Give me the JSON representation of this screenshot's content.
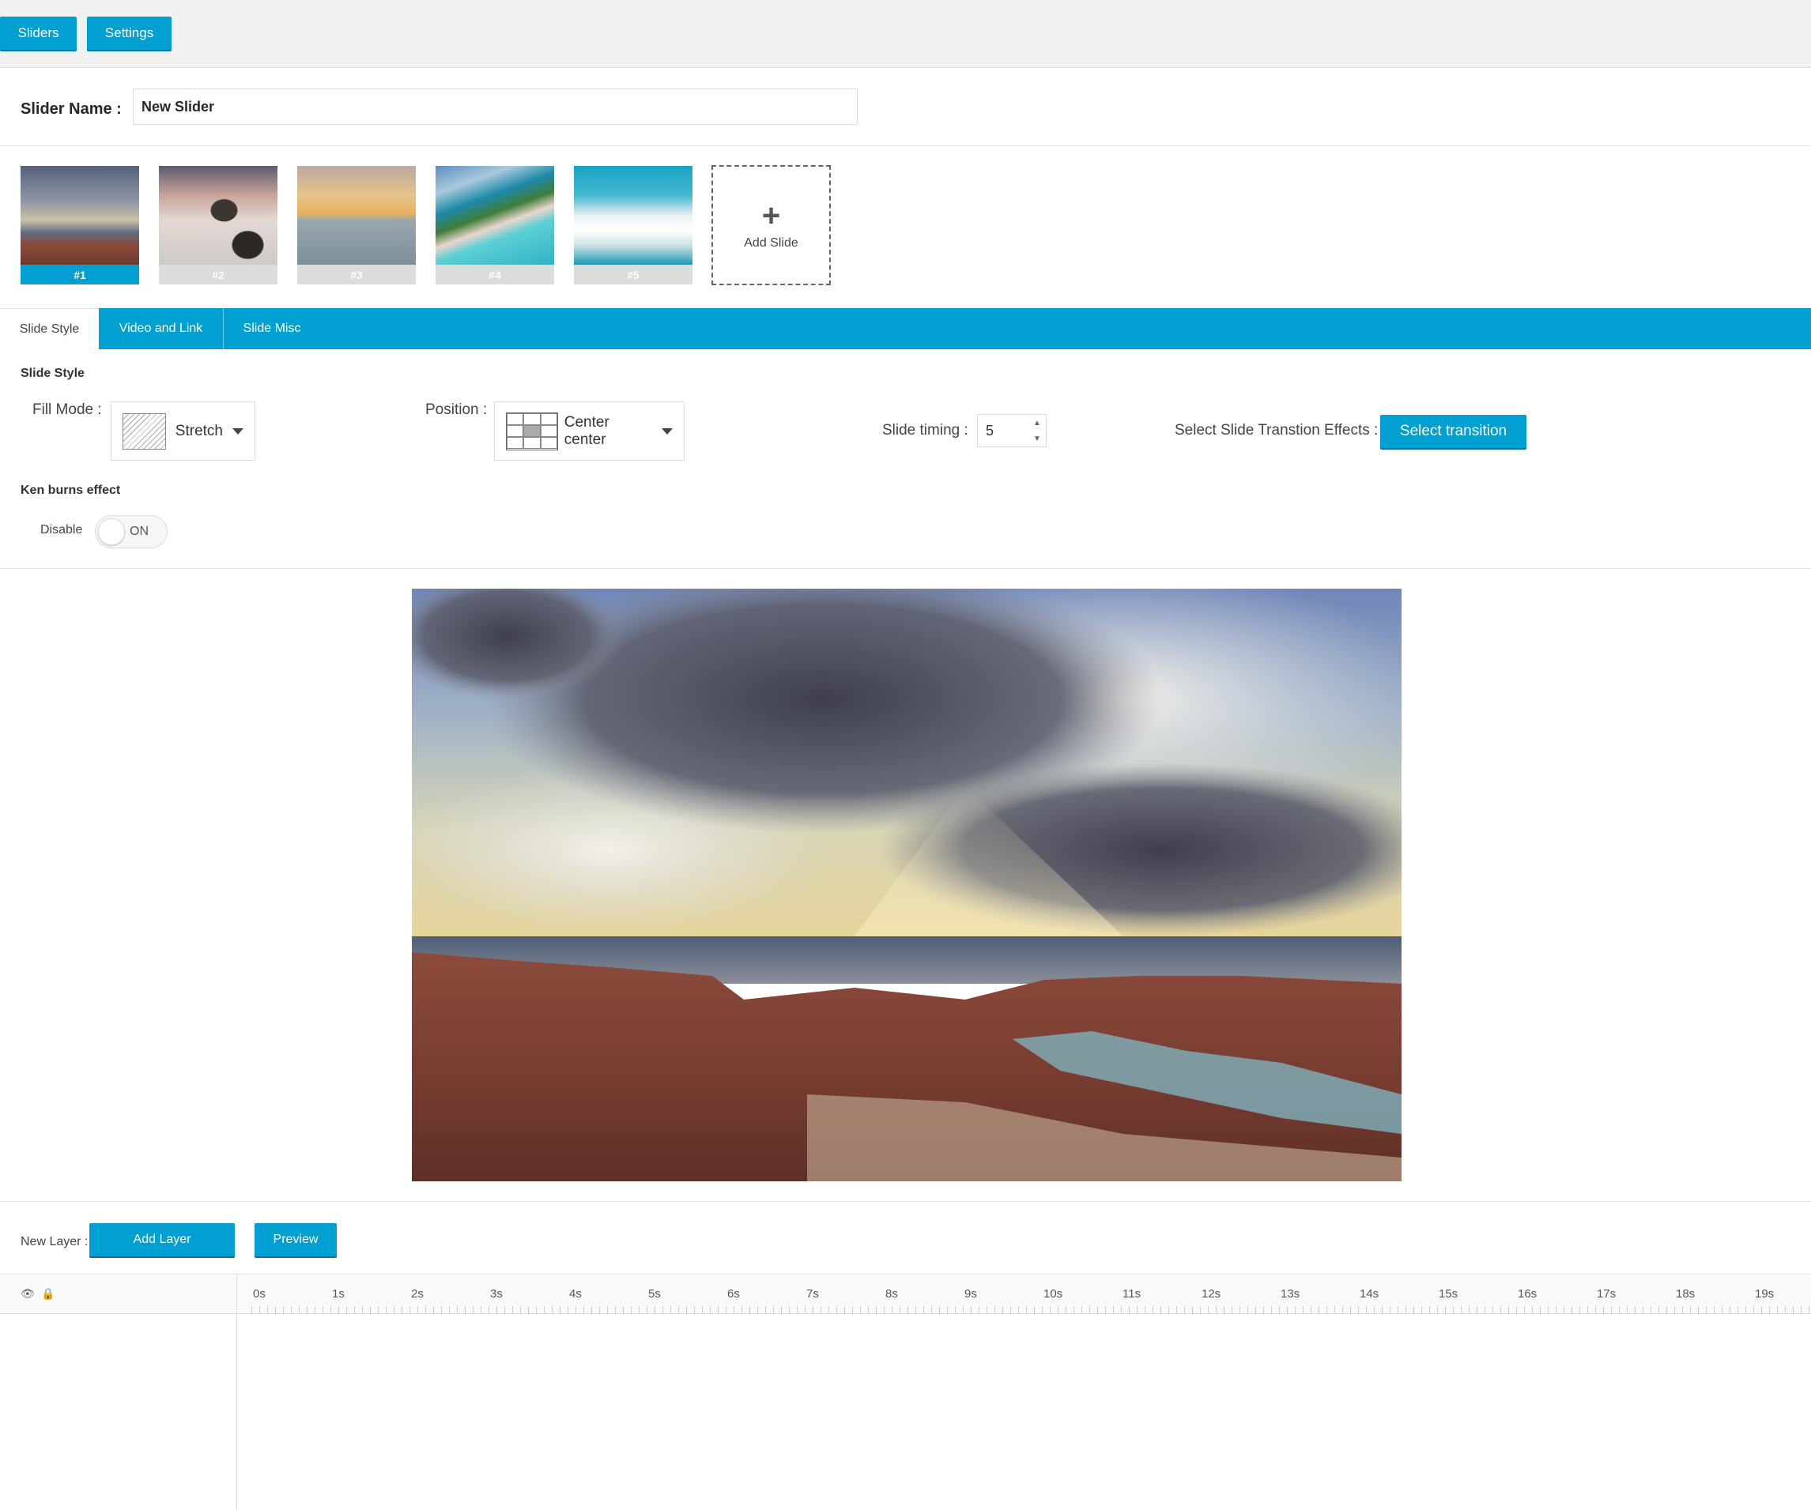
{
  "topbar": {
    "sliders_label": "Sliders",
    "settings_label": "Settings"
  },
  "slider_name": {
    "label": "Slider Name :",
    "value": "New Slider"
  },
  "slides": [
    {
      "label": "#1",
      "active": true
    },
    {
      "label": "#2",
      "active": false
    },
    {
      "label": "#3",
      "active": false
    },
    {
      "label": "#4",
      "active": false
    },
    {
      "label": "#5",
      "active": false
    }
  ],
  "add_slide": {
    "icon": "plus-icon",
    "label": "Add Slide"
  },
  "tabs": [
    {
      "label": "Slide Style",
      "active": true
    },
    {
      "label": "Video and Link",
      "active": false
    },
    {
      "label": "Slide Misc",
      "active": false
    }
  ],
  "slide_style": {
    "title": "Slide Style",
    "fill_mode_label": "Fill Mode :",
    "fill_mode_value": "Stretch",
    "position_label": "Position :",
    "position_value": "Center center",
    "timing_label": "Slide timing :",
    "timing_value": "5",
    "transition_label": "Select Slide Transtion Effects :",
    "transition_button": "Select transition"
  },
  "ken_burns": {
    "title": "Ken burns effect",
    "state_label": "Disable",
    "toggle_text": "ON"
  },
  "layers": {
    "new_layer_label": "New Layer :",
    "add_layer_button": "Add Layer",
    "preview_button": "Preview"
  },
  "timeline": {
    "icons": [
      "eye-icon",
      "lock-icon"
    ],
    "ticks": [
      "0s",
      "1s",
      "2s",
      "3s",
      "4s",
      "5s",
      "6s",
      "7s",
      "8s",
      "9s",
      "10s",
      "11s",
      "12s",
      "13s",
      "14s",
      "15s",
      "16s",
      "17s",
      "18s",
      "19s"
    ]
  },
  "colors": {
    "accent": "#00a0d2",
    "accent_dark": "#0073aa",
    "background": "#f1f1f1"
  }
}
